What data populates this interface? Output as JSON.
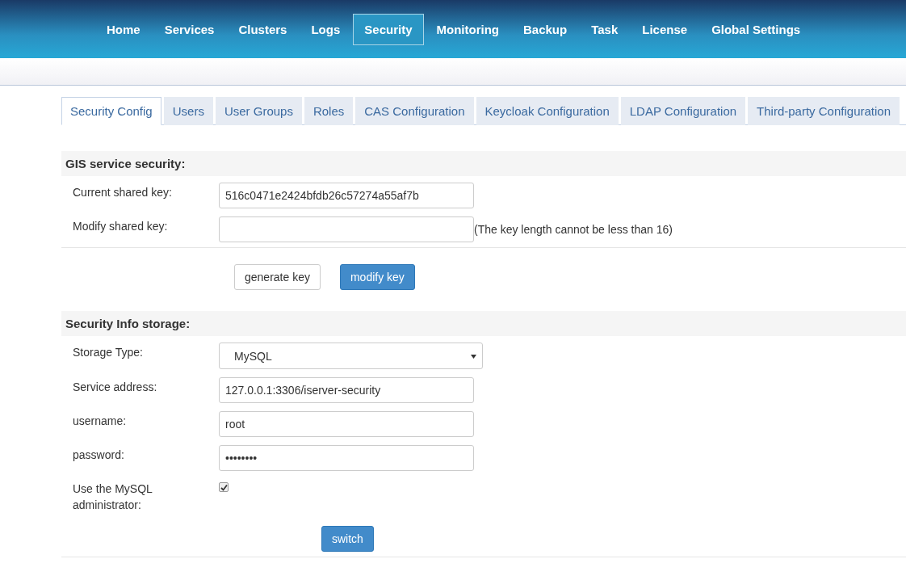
{
  "nav": [
    {
      "label": "Home",
      "selected": false
    },
    {
      "label": "Services",
      "selected": false
    },
    {
      "label": "Clusters",
      "selected": false
    },
    {
      "label": "Logs",
      "selected": false
    },
    {
      "label": "Security",
      "selected": true
    },
    {
      "label": "Monitoring",
      "selected": false
    },
    {
      "label": "Backup",
      "selected": false
    },
    {
      "label": "Task",
      "selected": false
    },
    {
      "label": "License",
      "selected": false
    },
    {
      "label": "Global Settings",
      "selected": false
    }
  ],
  "tabs": [
    {
      "label": "Security Config",
      "selected": true
    },
    {
      "label": "Users",
      "selected": false
    },
    {
      "label": "User Groups",
      "selected": false
    },
    {
      "label": "Roles",
      "selected": false
    },
    {
      "label": "CAS Configuration",
      "selected": false
    },
    {
      "label": "Keycloak Configuration",
      "selected": false
    },
    {
      "label": "LDAP Configuration",
      "selected": false
    },
    {
      "label": "Third-party Configuration",
      "selected": false
    }
  ],
  "sections": [
    {
      "title": "GIS service security:",
      "fields": [
        {
          "kind": "input",
          "label": "Current shared key:",
          "value": "516c0471e2424bfdb26c57274a55af7b"
        },
        {
          "kind": "input",
          "label": "Modify shared key:",
          "hint": "(The key length cannot be less than 16)"
        }
      ],
      "buttons": [
        {
          "label": "generate key",
          "kind": "default"
        },
        {
          "label": "modify key",
          "kind": "primary"
        }
      ]
    },
    {
      "title": "Security Info storage:",
      "fields": [
        {
          "kind": "select",
          "label": "Storage Type:",
          "value": "MySQL"
        },
        {
          "kind": "input",
          "label": "Service address:",
          "value": "127.0.0.1:3306/iserver-security"
        },
        {
          "kind": "input",
          "label": "username:",
          "value": "root"
        },
        {
          "kind": "input",
          "label": "password:",
          "value": "••••••••"
        },
        {
          "kind": "checkbox",
          "label": "Use the MySQL administrator:",
          "checked": true
        }
      ],
      "buttons": [
        {
          "label": "switch",
          "kind": "primary"
        }
      ]
    }
  ]
}
